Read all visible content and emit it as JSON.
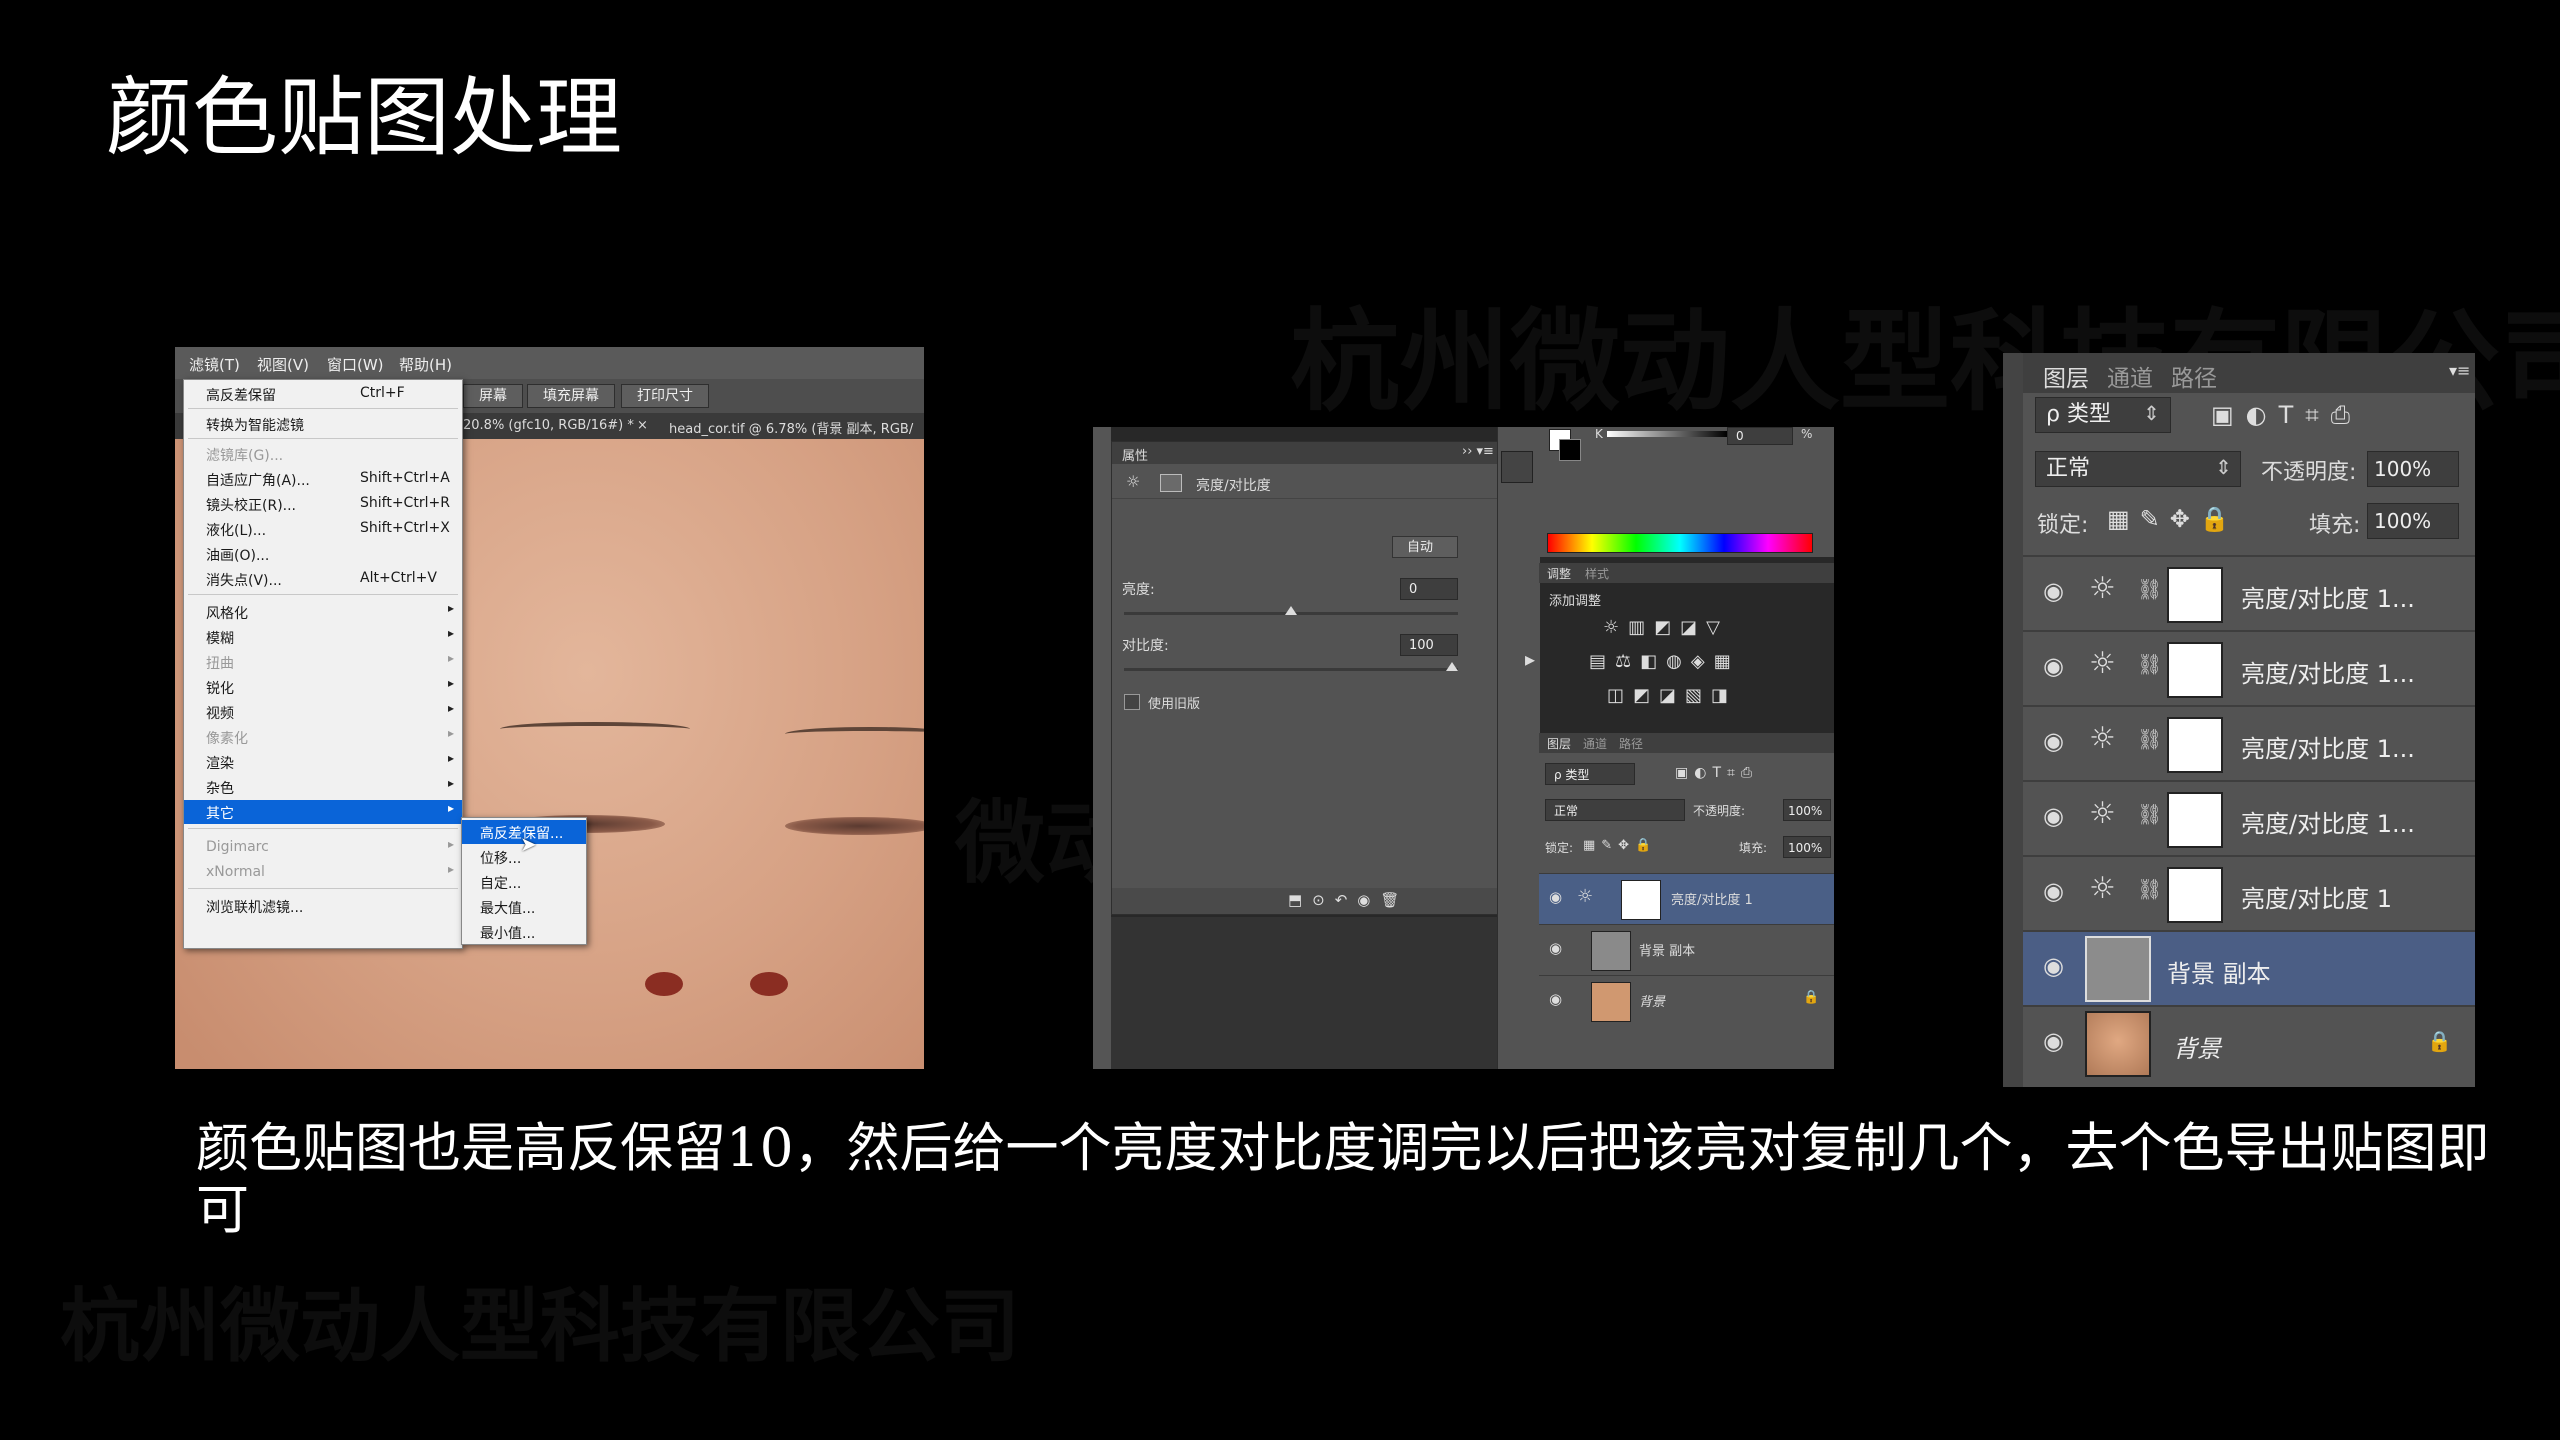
{
  "slide": {
    "title": "颜色贴图处理",
    "caption": "颜色贴图也是高反保留10，然后给一个亮度对比度调完以后把该亮对复制几个，去个色导出贴图即可"
  },
  "watermarks": [
    "杭州微动人型科技有限公司",
    "微动人型",
    "杭州微动人型科技有限公司"
  ],
  "shot1": {
    "menubar": [
      "滤镜(T)",
      "视图(V)",
      "窗口(W)",
      "帮助(H)"
    ],
    "optbar_buttons": [
      "屏幕",
      "填充屏幕",
      "打印尺寸"
    ],
    "tabs": [
      "20.8% (gfc10, RGB/16#) *",
      "×",
      "head_cor.tif @ 6.78% (背景 副本, RGB/"
    ],
    "menu": [
      {
        "label": "高反差保留",
        "shortcut": "Ctrl+F"
      },
      {
        "label": "转换为智能滤镜",
        "shortcut": ""
      },
      {
        "label": "滤镜库(G)...",
        "shortcut": ""
      },
      {
        "label": "自适应广角(A)...",
        "shortcut": "Shift+Ctrl+A"
      },
      {
        "label": "镜头校正(R)...",
        "shortcut": "Shift+Ctrl+R"
      },
      {
        "label": "液化(L)...",
        "shortcut": "Shift+Ctrl+X"
      },
      {
        "label": "油画(O)...",
        "shortcut": ""
      },
      {
        "label": "消失点(V)...",
        "shortcut": "Alt+Ctrl+V"
      },
      {
        "label": "风格化",
        "shortcut": ""
      },
      {
        "label": "模糊",
        "shortcut": ""
      },
      {
        "label": "扭曲",
        "shortcut": ""
      },
      {
        "label": "锐化",
        "shortcut": ""
      },
      {
        "label": "视频",
        "shortcut": ""
      },
      {
        "label": "像素化",
        "shortcut": ""
      },
      {
        "label": "渲染",
        "shortcut": ""
      },
      {
        "label": "杂色",
        "shortcut": ""
      },
      {
        "label": "其它",
        "shortcut": ""
      },
      {
        "label": "Digimarc",
        "shortcut": ""
      },
      {
        "label": "xNormal",
        "shortcut": ""
      },
      {
        "label": "浏览联机滤镜...",
        "shortcut": ""
      }
    ],
    "submenu": [
      "高反差保留...",
      "位移...",
      "自定...",
      "最大值...",
      "最小值..."
    ]
  },
  "shot2": {
    "panel_title": "属性",
    "adj_name": "亮度/对比度",
    "auto_button": "自动",
    "brightness_label": "亮度:",
    "brightness_value": "0",
    "contrast_label": "对比度:",
    "contrast_value": "100",
    "use_legacy": "使用旧版",
    "color_k": "K",
    "color_value": "0",
    "color_pct": "%",
    "adj_tabs": [
      "调整",
      "样式"
    ],
    "add_adjustment": "添加调整",
    "layer_tabs": [
      "图层",
      "通道",
      "路径"
    ],
    "kind_label": "ρ 类型",
    "blend_mode": "正常",
    "opacity_label": "不透明度:",
    "opacity_value": "100%",
    "lock_label": "锁定:",
    "fill_label": "填充:",
    "fill_value": "100%",
    "layers": [
      "亮度/对比度 1",
      "背景 副本",
      "背景"
    ]
  },
  "shot3": {
    "tabs": [
      "图层",
      "通道",
      "路径"
    ],
    "kind_label": "ρ 类型",
    "blend_mode": "正常",
    "opacity_label": "不透明度:",
    "opacity_value": "100%",
    "lock_label": "锁定:",
    "fill_label": "填充:",
    "fill_value": "100%",
    "layers": [
      "亮度/对比度 1...",
      "亮度/对比度 1...",
      "亮度/对比度 1...",
      "亮度/对比度 1...",
      "亮度/对比度 1",
      "背景 副本",
      "背景"
    ]
  }
}
